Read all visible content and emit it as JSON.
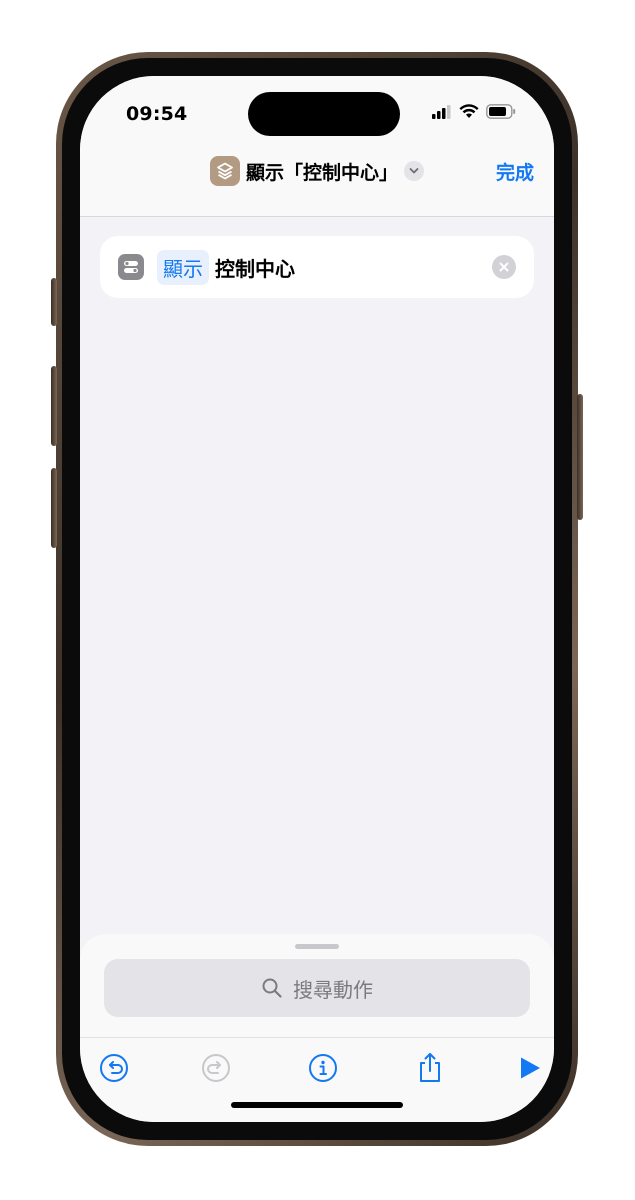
{
  "status_bar": {
    "time": "09:54"
  },
  "nav": {
    "title": "顯示「控制中心」",
    "done_label": "完成",
    "app_icon": "shortcuts-icon"
  },
  "action": {
    "verb": "顯示",
    "object": "控制中心",
    "icon": "toggles-icon"
  },
  "sheet": {
    "search_placeholder": "搜尋動作"
  },
  "toolbar": {
    "icons": [
      "undo-icon",
      "redo-icon",
      "info-icon",
      "share-icon",
      "play-icon"
    ]
  },
  "colors": {
    "accent": "#1478f2",
    "background": "#f2f2f7",
    "app_icon": "#b39a82"
  }
}
